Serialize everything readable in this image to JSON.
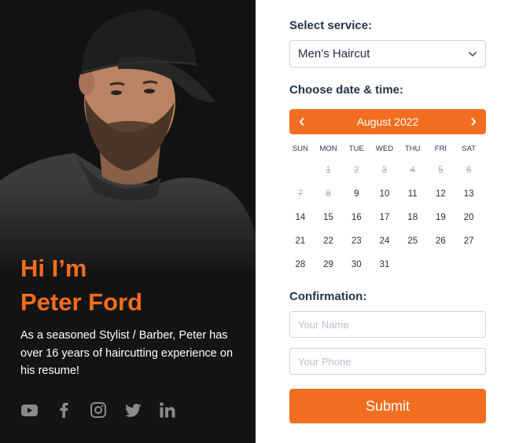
{
  "profile": {
    "greeting_line1": "Hi I’m",
    "greeting_line2": "Peter Ford",
    "bio": "As a seasoned Stylist / Barber, Peter has over 16 years of haircutting experience on his resume!",
    "social_icons": [
      "youtube-icon",
      "facebook-icon",
      "instagram-icon",
      "twitter-icon",
      "linkedin-icon"
    ]
  },
  "form": {
    "service_label": "Select service:",
    "service_value": "Men’s Haircut",
    "datetime_label": "Choose date & time:",
    "calendar": {
      "month": "August 2022",
      "weekdays": [
        "SUN",
        "MON",
        "TUE",
        "WED",
        "THU",
        "FRI",
        "SAT"
      ],
      "first_weekday_index": 1,
      "days_in_month": 31,
      "disabled_days": [
        1,
        2,
        3,
        4,
        5,
        6,
        7,
        8
      ]
    },
    "confirmation_label": "Confirmation:",
    "name_placeholder": "Your Name",
    "phone_placeholder": "Your Phone",
    "submit_label": "Submit"
  },
  "colors": {
    "accent": "#f26d1f",
    "panel": "#141414",
    "text": "#243547"
  }
}
